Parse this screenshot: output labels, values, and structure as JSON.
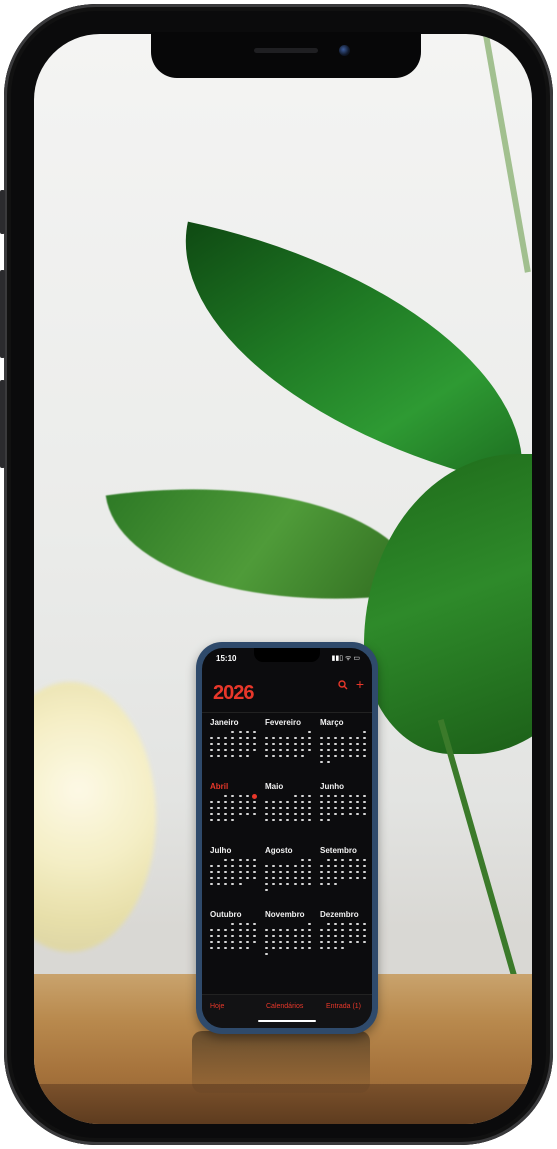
{
  "inner_phone": {
    "status_time": "15:10",
    "status_icons": "▮▮▯ ᯤ ▭",
    "year": "2026",
    "search_icon": "search-icon",
    "add_icon": "plus-icon",
    "search_label": "Q",
    "add_label": "+",
    "months": [
      {
        "name": "Janeiro",
        "current": false,
        "days": 31,
        "start": 3
      },
      {
        "name": "Fevereiro",
        "current": false,
        "days": 28,
        "start": 6
      },
      {
        "name": "Março",
        "current": false,
        "days": 31,
        "start": 6
      },
      {
        "name": "Abril",
        "current": true,
        "days": 30,
        "start": 2,
        "today": 5
      },
      {
        "name": "Maio",
        "current": false,
        "days": 31,
        "start": 4
      },
      {
        "name": "Junho",
        "current": false,
        "days": 30,
        "start": 0
      },
      {
        "name": "Julho",
        "current": false,
        "days": 31,
        "start": 2
      },
      {
        "name": "Agosto",
        "current": false,
        "days": 31,
        "start": 5
      },
      {
        "name": "Setembro",
        "current": false,
        "days": 30,
        "start": 1
      },
      {
        "name": "Outubro",
        "current": false,
        "days": 31,
        "start": 3
      },
      {
        "name": "Novembro",
        "current": false,
        "days": 30,
        "start": 6
      },
      {
        "name": "Dezembro",
        "current": false,
        "days": 31,
        "start": 1
      }
    ],
    "tabs": {
      "today": "Hoje",
      "calendars": "Calendários",
      "inbox": "Entrada (1)"
    },
    "accent": "#e8372a"
  }
}
